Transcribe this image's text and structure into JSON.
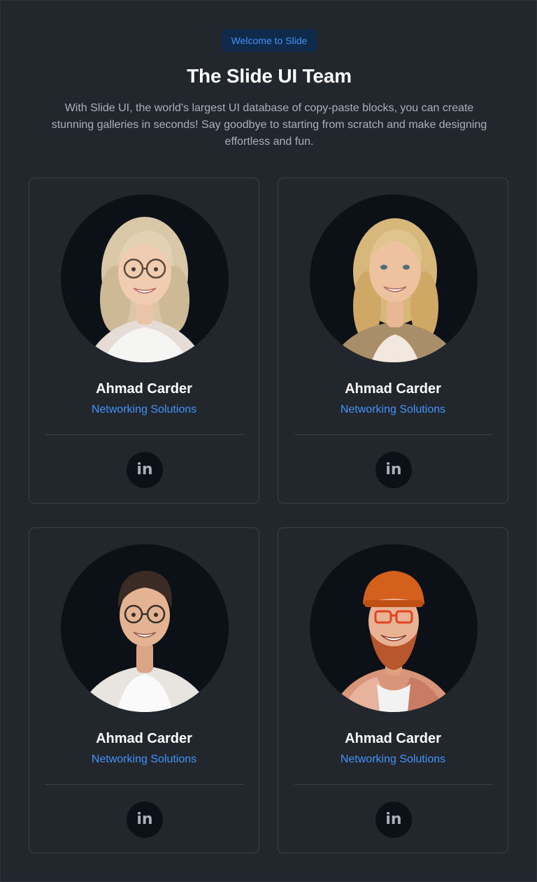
{
  "header": {
    "badge": "Welcome to Slide",
    "title": "The Slide UI Team",
    "subtitle": "With Slide UI, the world's largest UI database of copy-paste blocks, you can create stunning galleries in seconds! Say goodbye to starting from scratch and make designing effortless and fun."
  },
  "team": [
    {
      "name": "Ahmad Carder",
      "role": "Networking Solutions",
      "social_icon": "linkedin-icon",
      "social_label": "in",
      "avatar": "woman-blonde-glasses"
    },
    {
      "name": "Ahmad Carder",
      "role": "Networking Solutions",
      "social_icon": "linkedin-icon",
      "social_label": "in",
      "avatar": "woman-blonde"
    },
    {
      "name": "Ahmad Carder",
      "role": "Networking Solutions",
      "social_icon": "linkedin-icon",
      "social_label": "in",
      "avatar": "man-glasses"
    },
    {
      "name": "Ahmad Carder",
      "role": "Networking Solutions",
      "social_icon": "linkedin-icon",
      "social_label": "in",
      "avatar": "man-beanie-beard"
    }
  ],
  "colors": {
    "background": "#22272e",
    "accent": "#4493f8",
    "badge_bg": "#0f2a4a",
    "avatar_bg": "#0c1118"
  }
}
